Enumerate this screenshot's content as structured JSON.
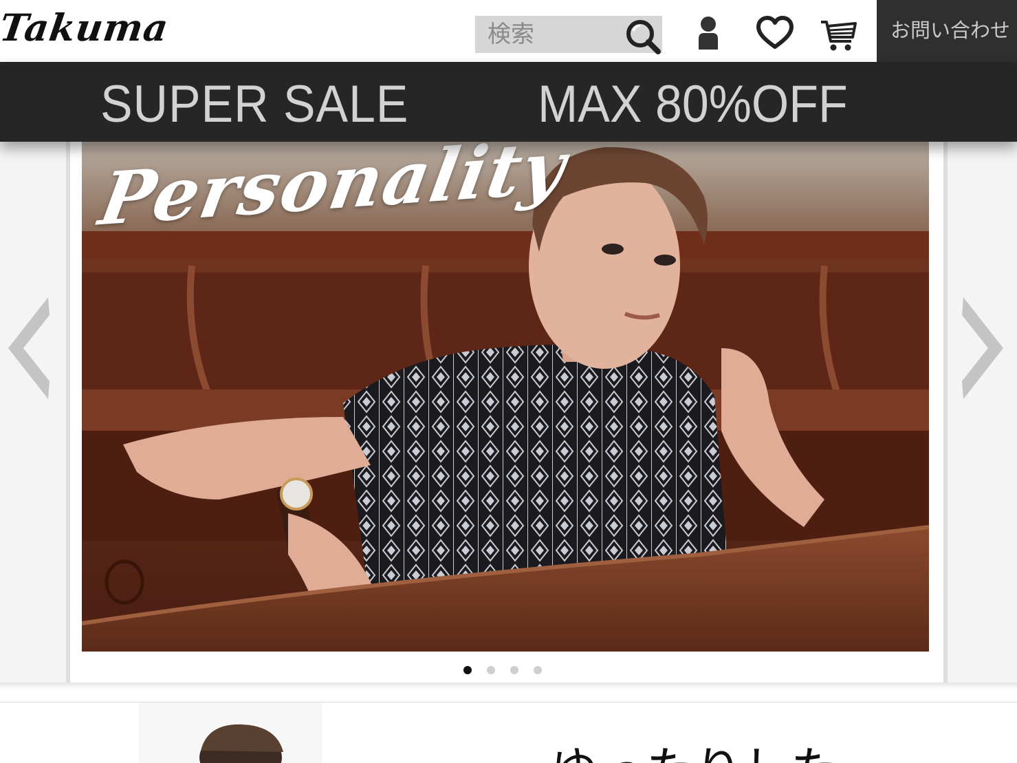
{
  "brand": {
    "logo_text": "Takuma"
  },
  "header": {
    "search_placeholder": "検索",
    "contact_label": "お問い合わせ",
    "icons": [
      "search-icon",
      "user-icon",
      "heart-icon",
      "cart-icon"
    ]
  },
  "sale_banner": {
    "left_text": "SUPER SALE",
    "right_text": "MAX 80%OFF"
  },
  "carousel": {
    "slide_title": "Personality",
    "slide_count": 4,
    "active_slide": 1
  },
  "next_section": {
    "heading_partial": "ゆったりした"
  },
  "colors": {
    "header_bg": "#ffffff",
    "contact_bg": "#2f2f2f",
    "banner_bg": "#262626",
    "banner_text": "#d2d2d2",
    "search_bg": "#d6d6d6",
    "arrow": "#c4c4c4",
    "dot_active": "#111111",
    "dot_inactive": "#cfcfcf"
  }
}
